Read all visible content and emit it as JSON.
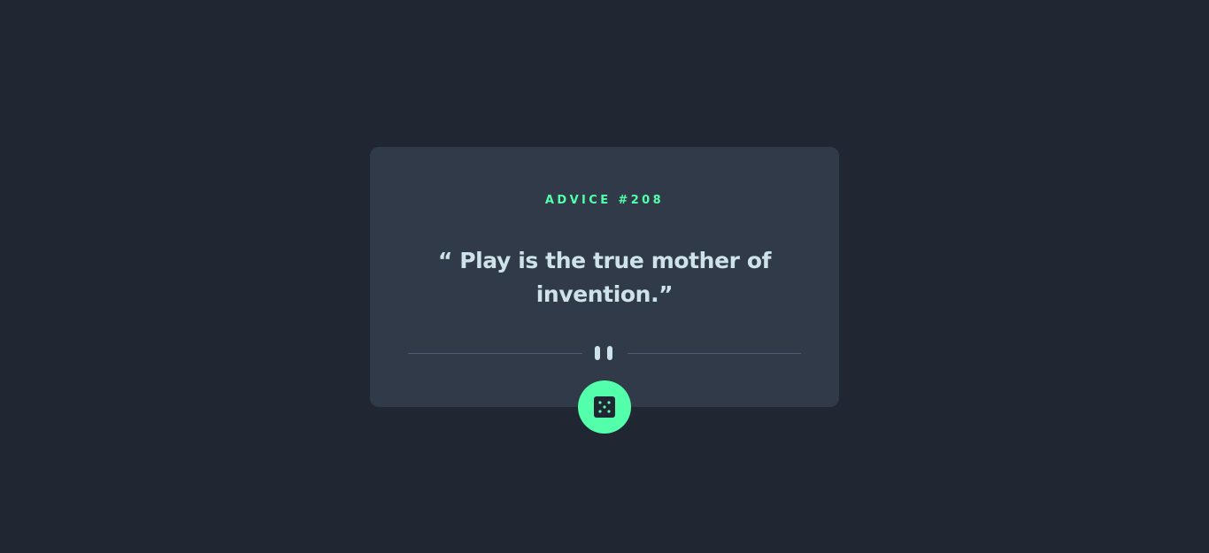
{
  "card": {
    "advice_label": "ADVICE #208",
    "quote_text": "“ Play is the true mother of invention.”"
  },
  "divider": {
    "icon": "pause-icon"
  },
  "dice_button": {
    "icon": "dice-icon"
  },
  "colors": {
    "background": "#202632",
    "card": "#313a48",
    "accent": "#53ffaa",
    "text": "#cee3e9",
    "divider": "#4f5d74"
  }
}
